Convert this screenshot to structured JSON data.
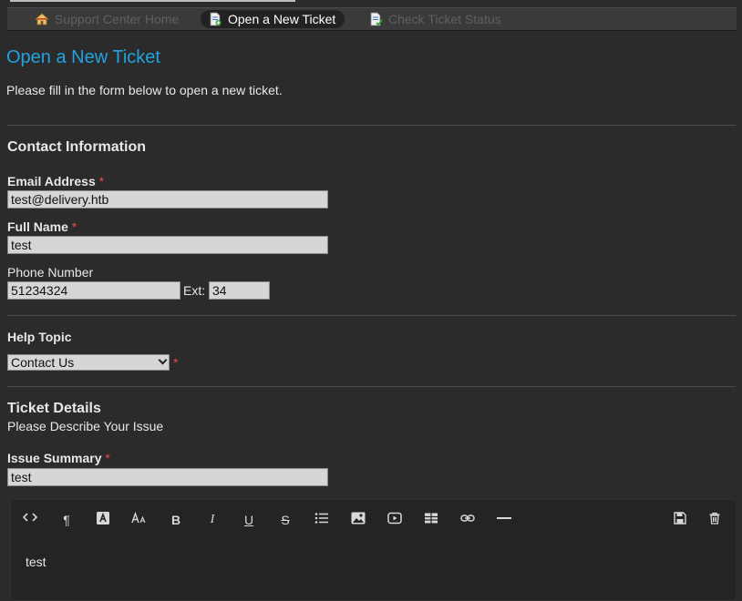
{
  "nav": {
    "items": [
      {
        "label": "Support Center Home",
        "icon": "home-icon",
        "active": false
      },
      {
        "label": "Open a New Ticket",
        "icon": "new-ticket-icon",
        "active": true
      },
      {
        "label": "Check Ticket Status",
        "icon": "ticket-status-icon",
        "active": false
      }
    ]
  },
  "page": {
    "title": "Open a New Ticket",
    "intro": "Please fill in the form below to open a new ticket."
  },
  "contact": {
    "heading": "Contact Information",
    "email": {
      "label": "Email Address",
      "required": "*",
      "value": "test@delivery.htb"
    },
    "name": {
      "label": "Full Name",
      "required": "*",
      "value": "test"
    },
    "phone": {
      "label": "Phone Number",
      "value": "51234324",
      "ext_label": "Ext:",
      "ext_value": "34"
    }
  },
  "help_topic": {
    "label": "Help Topic",
    "selected": "Contact Us",
    "required": "*"
  },
  "ticket": {
    "heading": "Ticket Details",
    "subheading": "Please Describe Your Issue",
    "summary": {
      "label": "Issue Summary",
      "required": "*",
      "value": "test"
    },
    "body": "test"
  },
  "editor_toolbar": [
    "code-view-icon",
    "paragraph-icon",
    "text-color-icon",
    "font-size-icon",
    "bold-icon",
    "italic-icon",
    "underline-icon",
    "strikethrough-icon",
    "bulleted-list-icon",
    "image-icon",
    "video-icon",
    "table-icon",
    "link-icon",
    "horizontal-rule-icon",
    "save-draft-icon",
    "delete-draft-icon"
  ],
  "colors": {
    "accent": "#23a2df",
    "required": "#e54b4b",
    "background": "#2b2b2b"
  }
}
